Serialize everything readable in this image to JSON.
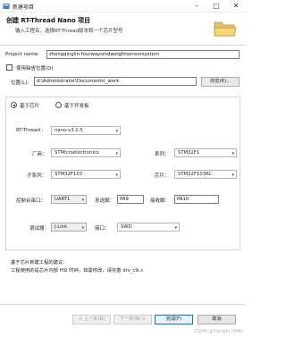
{
  "window": {
    "title": "新建项目",
    "controls": [
      "minimize-icon",
      "maximize-icon",
      "close-icon"
    ]
  },
  "header": {
    "title": "创建 RT-Thread Nano 项目",
    "description": "输入工程名，选择RT-Thread版本和一个芯片型号"
  },
  "project": {
    "name_label": "Project name:",
    "name_value": "zhongqinglin-fourwaysmdweightsensorsystem",
    "use_default_label": "使用缺省位置(D)",
    "use_default_checked": false,
    "location_label": "位置(L):",
    "location_value": "d:\\Administrator\\Documents\\_work",
    "browse_label": "浏览(R)..."
  },
  "mode": {
    "options": [
      "基于芯片",
      "基于开发板"
    ],
    "selected": "基于芯片"
  },
  "form": {
    "rtthread_label": "RT-Thread :",
    "rtthread_value": "nano-v3.1.5",
    "vendor_label": "厂商：",
    "vendor_value": "STMicroelectronics",
    "series_label": "系列：",
    "series_value": "STM32F1",
    "subseries_label": "子系列：",
    "subseries_value": "STM32F103",
    "chip_label": "芯片：",
    "chip_value": "STM32F103RC",
    "console_label": "控制台串口：",
    "console_value": "UART1",
    "tx_label": "发送脚：",
    "tx_value": "PA9",
    "rx_label": "接收脚：",
    "rx_value": "PA10",
    "debugger_label": "调试器：",
    "debugger_value": "J-Link",
    "interface_label": "接口：",
    "interface_value": "SWD"
  },
  "info": {
    "heading": "基于芯片新建工程的建议：",
    "text": "工程使用的是芯片内部 HSI 时钟，如需修改，请完善 drv_clk.c"
  },
  "footer": {
    "back_label": "< 上一步(B)",
    "next_label": "下一步(N) >",
    "finish_label": "完成(F)",
    "cancel_label": "取消"
  },
  "watermark": "CSDN @Xiangfu DING"
}
